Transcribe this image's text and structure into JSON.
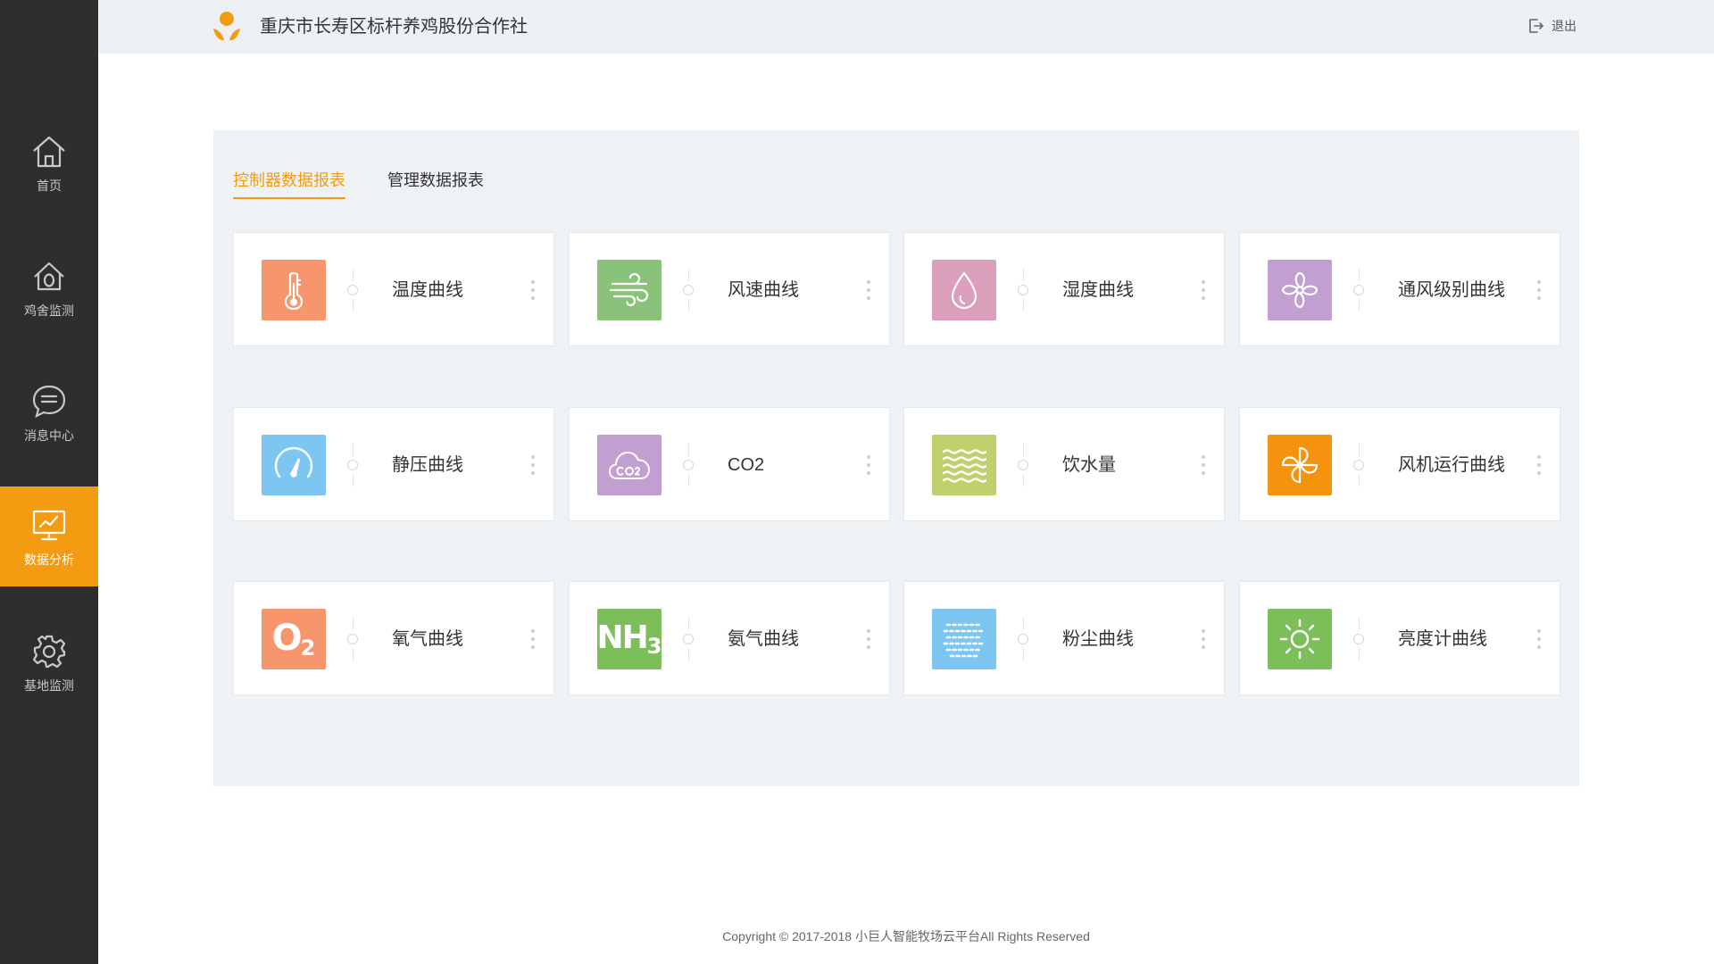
{
  "sidebar": {
    "items": [
      {
        "label": "首页",
        "icon": "home-icon",
        "active": false
      },
      {
        "label": "鸡舍监测",
        "icon": "henhouse-icon",
        "active": false
      },
      {
        "label": "消息中心",
        "icon": "message-icon",
        "active": false
      },
      {
        "label": "数据分析",
        "icon": "chart-monitor-icon",
        "active": true
      },
      {
        "label": "基地监测",
        "icon": "gear-icon",
        "active": false
      }
    ]
  },
  "header": {
    "title": "重庆市长寿区标杆养鸡股份合作社",
    "logout_label": "退出"
  },
  "tabs": [
    {
      "label": "控制器数据报表",
      "active": true
    },
    {
      "label": "管理数据报表",
      "active": false
    }
  ],
  "cards": [
    {
      "label": "温度曲线",
      "icon": "thermometer-icon",
      "color": "#f7956c"
    },
    {
      "label": "风速曲线",
      "icon": "wind-icon",
      "color": "#8bc27a"
    },
    {
      "label": "湿度曲线",
      "icon": "water-drop-icon",
      "color": "#dc9fbb"
    },
    {
      "label": "通风级别曲线",
      "icon": "fan-icon",
      "color": "#c29fd2"
    },
    {
      "label": "静压曲线",
      "icon": "gauge-icon",
      "color": "#7dc6f2"
    },
    {
      "label": "CO2",
      "icon": "co2-cloud-icon",
      "color": "#c29fd2"
    },
    {
      "label": "饮水量",
      "icon": "water-waves-icon",
      "color": "#bfd16c"
    },
    {
      "label": "风机运行曲线",
      "icon": "pinwheel-icon",
      "color": "#f5930e"
    },
    {
      "label": "氧气曲线",
      "icon": "oxygen-icon",
      "color": "#f7956c",
      "icon_text": "O",
      "icon_sub": "2"
    },
    {
      "label": "氨气曲线",
      "icon": "ammonia-icon",
      "color": "#7cbf5a",
      "icon_text": "NH",
      "icon_sub": "3"
    },
    {
      "label": "粉尘曲线",
      "icon": "dust-icon",
      "color": "#7dc6f2"
    },
    {
      "label": "亮度计曲线",
      "icon": "sun-icon",
      "color": "#7cbf5a"
    }
  ],
  "footer": {
    "copyright": "Copyright © 2017-2018 小巨人智能牧场云平台All Rights Reserved"
  }
}
